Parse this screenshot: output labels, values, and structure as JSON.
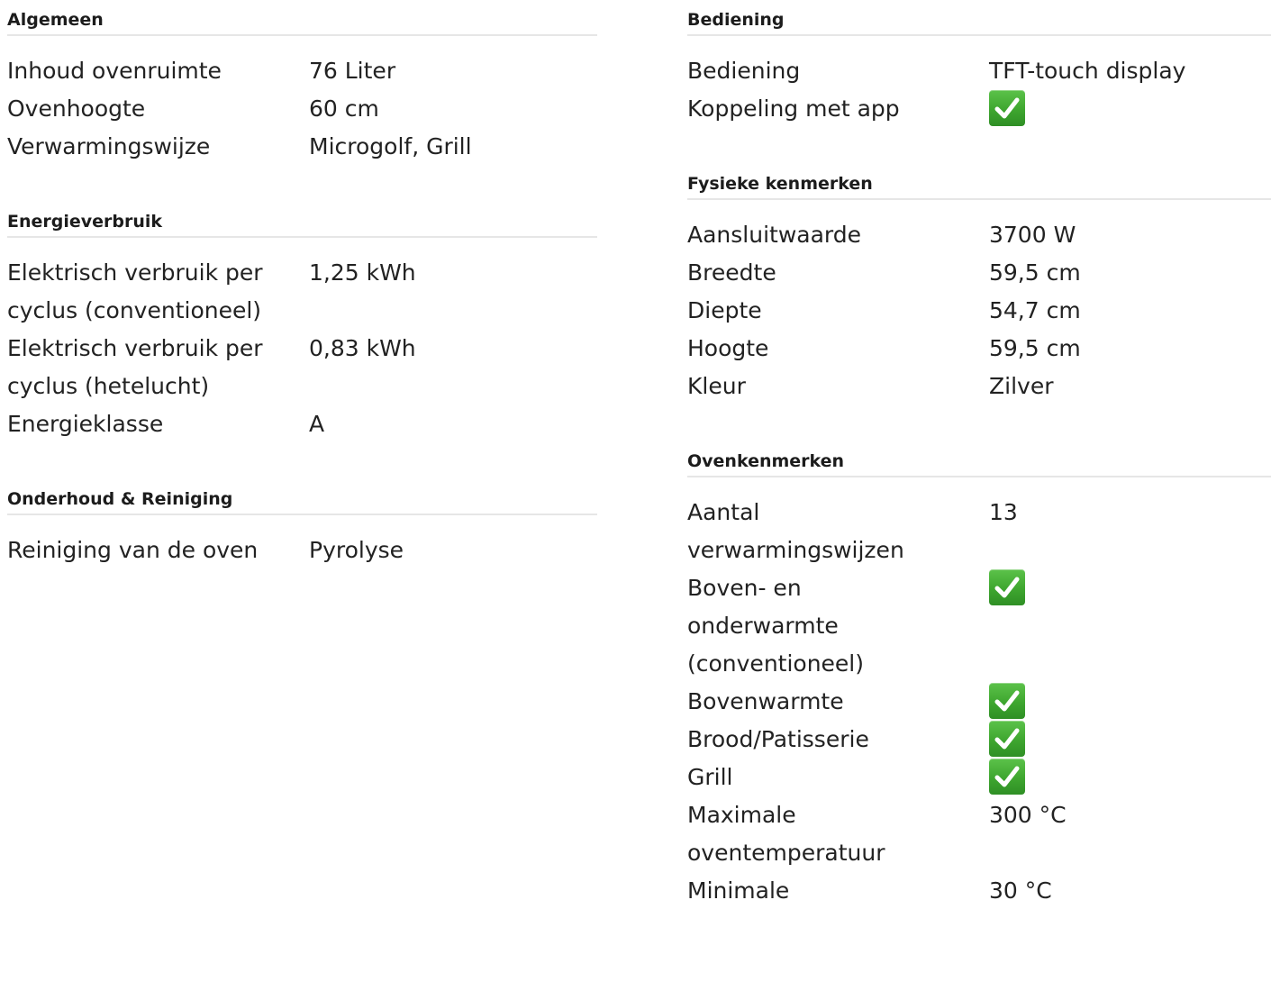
{
  "left": {
    "sections": [
      {
        "title": "Algemeen",
        "rows": [
          {
            "label": "Inhoud ovenruimte",
            "value": "76 Liter"
          },
          {
            "label": "Ovenhoogte",
            "value": "60 cm"
          },
          {
            "label": "Verwarmingswijze",
            "value": "Microgolf, Grill"
          }
        ]
      },
      {
        "title": "Energieverbruik",
        "rows": [
          {
            "label": "Elektrisch verbruik per cyclus (conventioneel)",
            "value": "1,25 kWh"
          },
          {
            "label": "Elektrisch verbruik per cyclus (hetelucht)",
            "value": "0,83 kWh"
          },
          {
            "label": "Energieklasse",
            "value": "A"
          }
        ]
      },
      {
        "title": "Onderhoud & Reiniging",
        "rows": [
          {
            "label": "Reiniging van de oven",
            "value": "Pyrolyse"
          }
        ]
      }
    ]
  },
  "right": {
    "sections": [
      {
        "title": "Bediening",
        "rows": [
          {
            "label": "Bediening",
            "value": "TFT-touch display"
          },
          {
            "label": "Koppeling met app",
            "value": "",
            "check": true
          }
        ]
      },
      {
        "title": "Fysieke kenmerken",
        "rows": [
          {
            "label": "Aansluitwaarde",
            "value": "3700 W"
          },
          {
            "label": "Breedte",
            "value": "59,5 cm"
          },
          {
            "label": "Diepte",
            "value": "54,7 cm"
          },
          {
            "label": "Hoogte",
            "value": "59,5 cm"
          },
          {
            "label": "Kleur",
            "value": "Zilver"
          }
        ]
      },
      {
        "title": "Ovenkenmerken",
        "rows": [
          {
            "label": "Aantal verwarmingswijzen",
            "value": "13"
          },
          {
            "label": "Boven- en onderwarmte (conventioneel)",
            "value": "",
            "check": true
          },
          {
            "label": "Bovenwarmte",
            "value": "",
            "check": true
          },
          {
            "label": "Brood/Patisserie",
            "value": "",
            "check": true
          },
          {
            "label": "Grill",
            "value": "",
            "check": true
          },
          {
            "label": "Maximale oventemperatuur",
            "value": "300 °C"
          },
          {
            "label": "Minimale",
            "value": "30 °C"
          }
        ]
      }
    ]
  },
  "icons": {
    "check": "checkmark-icon"
  },
  "colors": {
    "check_green": "#3ea62f",
    "divider": "#e6e6e6",
    "text": "#222222"
  }
}
